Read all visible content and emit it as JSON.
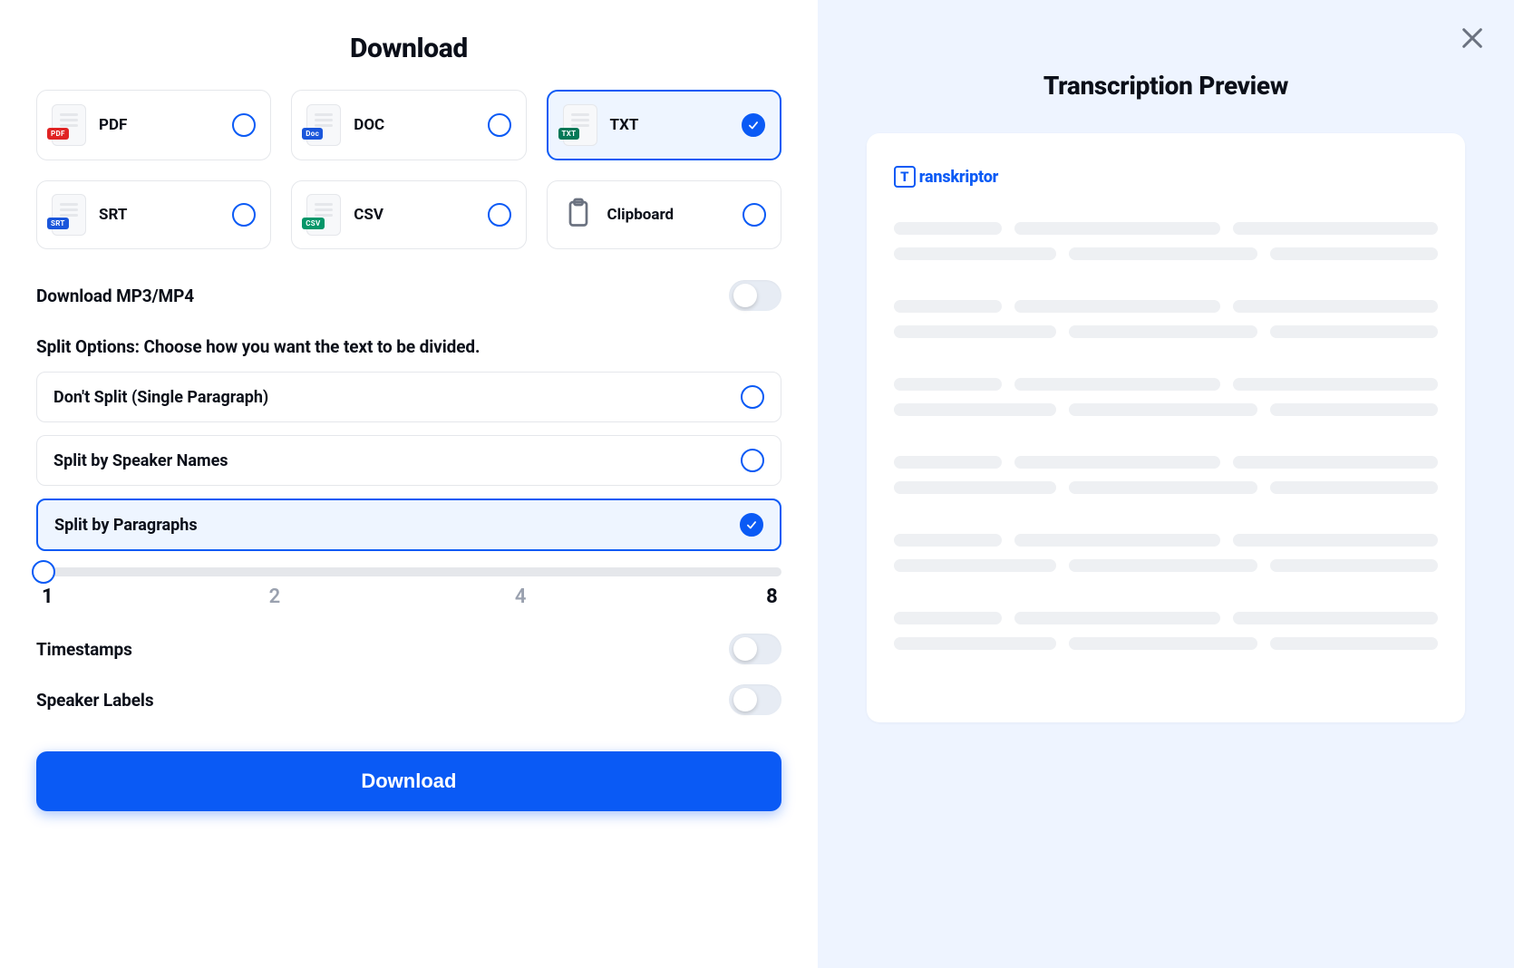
{
  "left": {
    "title": "Download",
    "formats": [
      {
        "label": "PDF",
        "badge_class": "badge-pdf",
        "badge_text": "PDF",
        "selected": false
      },
      {
        "label": "DOC",
        "badge_class": "badge-doc",
        "badge_text": "Doc",
        "selected": false
      },
      {
        "label": "TXT",
        "badge_class": "badge-txt",
        "badge_text": "TXT",
        "selected": true
      },
      {
        "label": "SRT",
        "badge_class": "badge-srt",
        "badge_text": "SRT",
        "selected": false
      },
      {
        "label": "CSV",
        "badge_class": "badge-csv",
        "badge_text": "CSV",
        "selected": false
      },
      {
        "label": "Clipboard",
        "clipboard": true,
        "selected": false
      }
    ],
    "mp3_mp4_label": "Download MP3/MP4",
    "mp3_mp4_on": false,
    "split_caption": "Split Options: Choose how you want the text to be divided.",
    "split_options": [
      {
        "label": "Don't Split (Single Paragraph)",
        "selected": false
      },
      {
        "label": "Split by Speaker Names",
        "selected": false
      },
      {
        "label": "Split by Paragraphs",
        "selected": true
      }
    ],
    "slider": {
      "ticks": [
        "1",
        "2",
        "4",
        "8"
      ],
      "value": 1,
      "percent": 1
    },
    "timestamps_label": "Timestamps",
    "timestamps_on": false,
    "speaker_labels_label": "Speaker Labels",
    "speaker_labels_on": false,
    "download_button": "Download"
  },
  "right": {
    "title": "Transcription Preview",
    "brand_mark_letter": "T",
    "brand_text": "ranskriptor"
  }
}
